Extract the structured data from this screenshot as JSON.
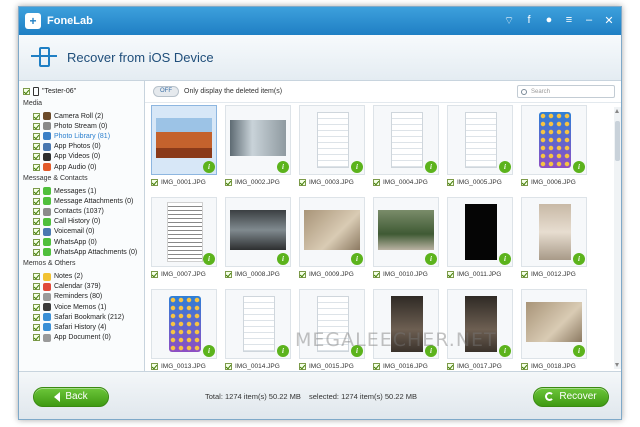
{
  "app": {
    "name": "FoneLab",
    "header_title": "Recover from iOS Device"
  },
  "titlebar_icons": [
    "wifi-icon",
    "facebook-icon",
    "chat-icon",
    "menu-icon",
    "minimize-icon",
    "close-icon"
  ],
  "titlebar_glyphs": {
    "wifi": "⌔",
    "facebook": "f",
    "chat": "●",
    "menu": "≡",
    "minimize": "–",
    "close": "✕"
  },
  "device": {
    "name": "\"Tester-06\""
  },
  "sidebar": {
    "categories": [
      {
        "title": "Media",
        "items": [
          {
            "label": "Camera Roll (2)",
            "color": "#6b4a2a"
          },
          {
            "label": "Photo Stream (0)",
            "color": "#8a8a8a"
          },
          {
            "label": "Photo Library (81)",
            "color": "#3a7fc6",
            "selected": true
          },
          {
            "label": "App Photos (0)",
            "color": "#4a78b0"
          },
          {
            "label": "App Videos (0)",
            "color": "#2e2e2e"
          },
          {
            "label": "App Audio (0)",
            "color": "#e25a2a"
          }
        ]
      },
      {
        "title": "Message & Contacts",
        "items": [
          {
            "label": "Messages (1)",
            "color": "#4fbf3c"
          },
          {
            "label": "Message Attachments (0)",
            "color": "#4fbf3c"
          },
          {
            "label": "Contacts (1037)",
            "color": "#8b8b8b"
          },
          {
            "label": "Call History (0)",
            "color": "#4fbf3c"
          },
          {
            "label": "Voicemail (0)",
            "color": "#4a78b0"
          },
          {
            "label": "WhatsApp (0)",
            "color": "#4fbf3c"
          },
          {
            "label": "WhatsApp Attachments (0)",
            "color": "#4fbf3c"
          }
        ]
      },
      {
        "title": "Memos & Others",
        "items": [
          {
            "label": "Notes (2)",
            "color": "#f1c232"
          },
          {
            "label": "Calendar (379)",
            "color": "#e04a3a"
          },
          {
            "label": "Reminders (80)",
            "color": "#9a9a9a"
          },
          {
            "label": "Voice Memos (1)",
            "color": "#3a3a3a"
          },
          {
            "label": "Safari Bookmark (212)",
            "color": "#3a8fd6"
          },
          {
            "label": "Safari History (4)",
            "color": "#3a8fd6"
          },
          {
            "label": "App Document (0)",
            "color": "#9a9a9a"
          }
        ]
      }
    ]
  },
  "toolbar": {
    "toggle_label": "OFF",
    "filter_label": "Only display the deleted item(s)",
    "search_placeholder": "Search"
  },
  "thumbnails": [
    {
      "name": "IMG_0001.JPG",
      "kind": "landscape",
      "selected": true
    },
    {
      "name": "IMG_0002.JPG",
      "kind": "landscape-grey"
    },
    {
      "name": "IMG_0003.JPG",
      "kind": "screenshot"
    },
    {
      "name": "IMG_0004.JPG",
      "kind": "screenshot"
    },
    {
      "name": "IMG_0005.JPG",
      "kind": "screenshot"
    },
    {
      "name": "IMG_0006.JPG",
      "kind": "homescreen"
    },
    {
      "name": "IMG_0007.JPG",
      "kind": "document"
    },
    {
      "name": "IMG_0008.JPG",
      "kind": "landscape-dark"
    },
    {
      "name": "IMG_0009.JPG",
      "kind": "landscape-beige"
    },
    {
      "name": "IMG_0010.JPG",
      "kind": "landscape-plant"
    },
    {
      "name": "IMG_0011.JPG",
      "kind": "black"
    },
    {
      "name": "IMG_0012.JPG",
      "kind": "portrait-beige"
    },
    {
      "name": "IMG_0013.JPG",
      "kind": "homescreen"
    },
    {
      "name": "IMG_0014.JPG",
      "kind": "screenshot"
    },
    {
      "name": "IMG_0015.JPG",
      "kind": "screenshot"
    },
    {
      "name": "IMG_0016.JPG",
      "kind": "portrait-dark"
    },
    {
      "name": "IMG_0017.JPG",
      "kind": "portrait-dark"
    },
    {
      "name": "IMG_0018.JPG",
      "kind": "landscape-beige"
    }
  ],
  "footer": {
    "back_label": "Back",
    "recover_label": "Recover",
    "total": "Total: 1274 item(s) 50.22 MB",
    "selected": "selected: 1274 item(s) 50.22 MB"
  },
  "watermark": "MEGALEECHER.NET",
  "colors": {
    "accent": "#1f7fc4",
    "button_green": "#4fae1f",
    "info_badge": "#5cb31c"
  }
}
